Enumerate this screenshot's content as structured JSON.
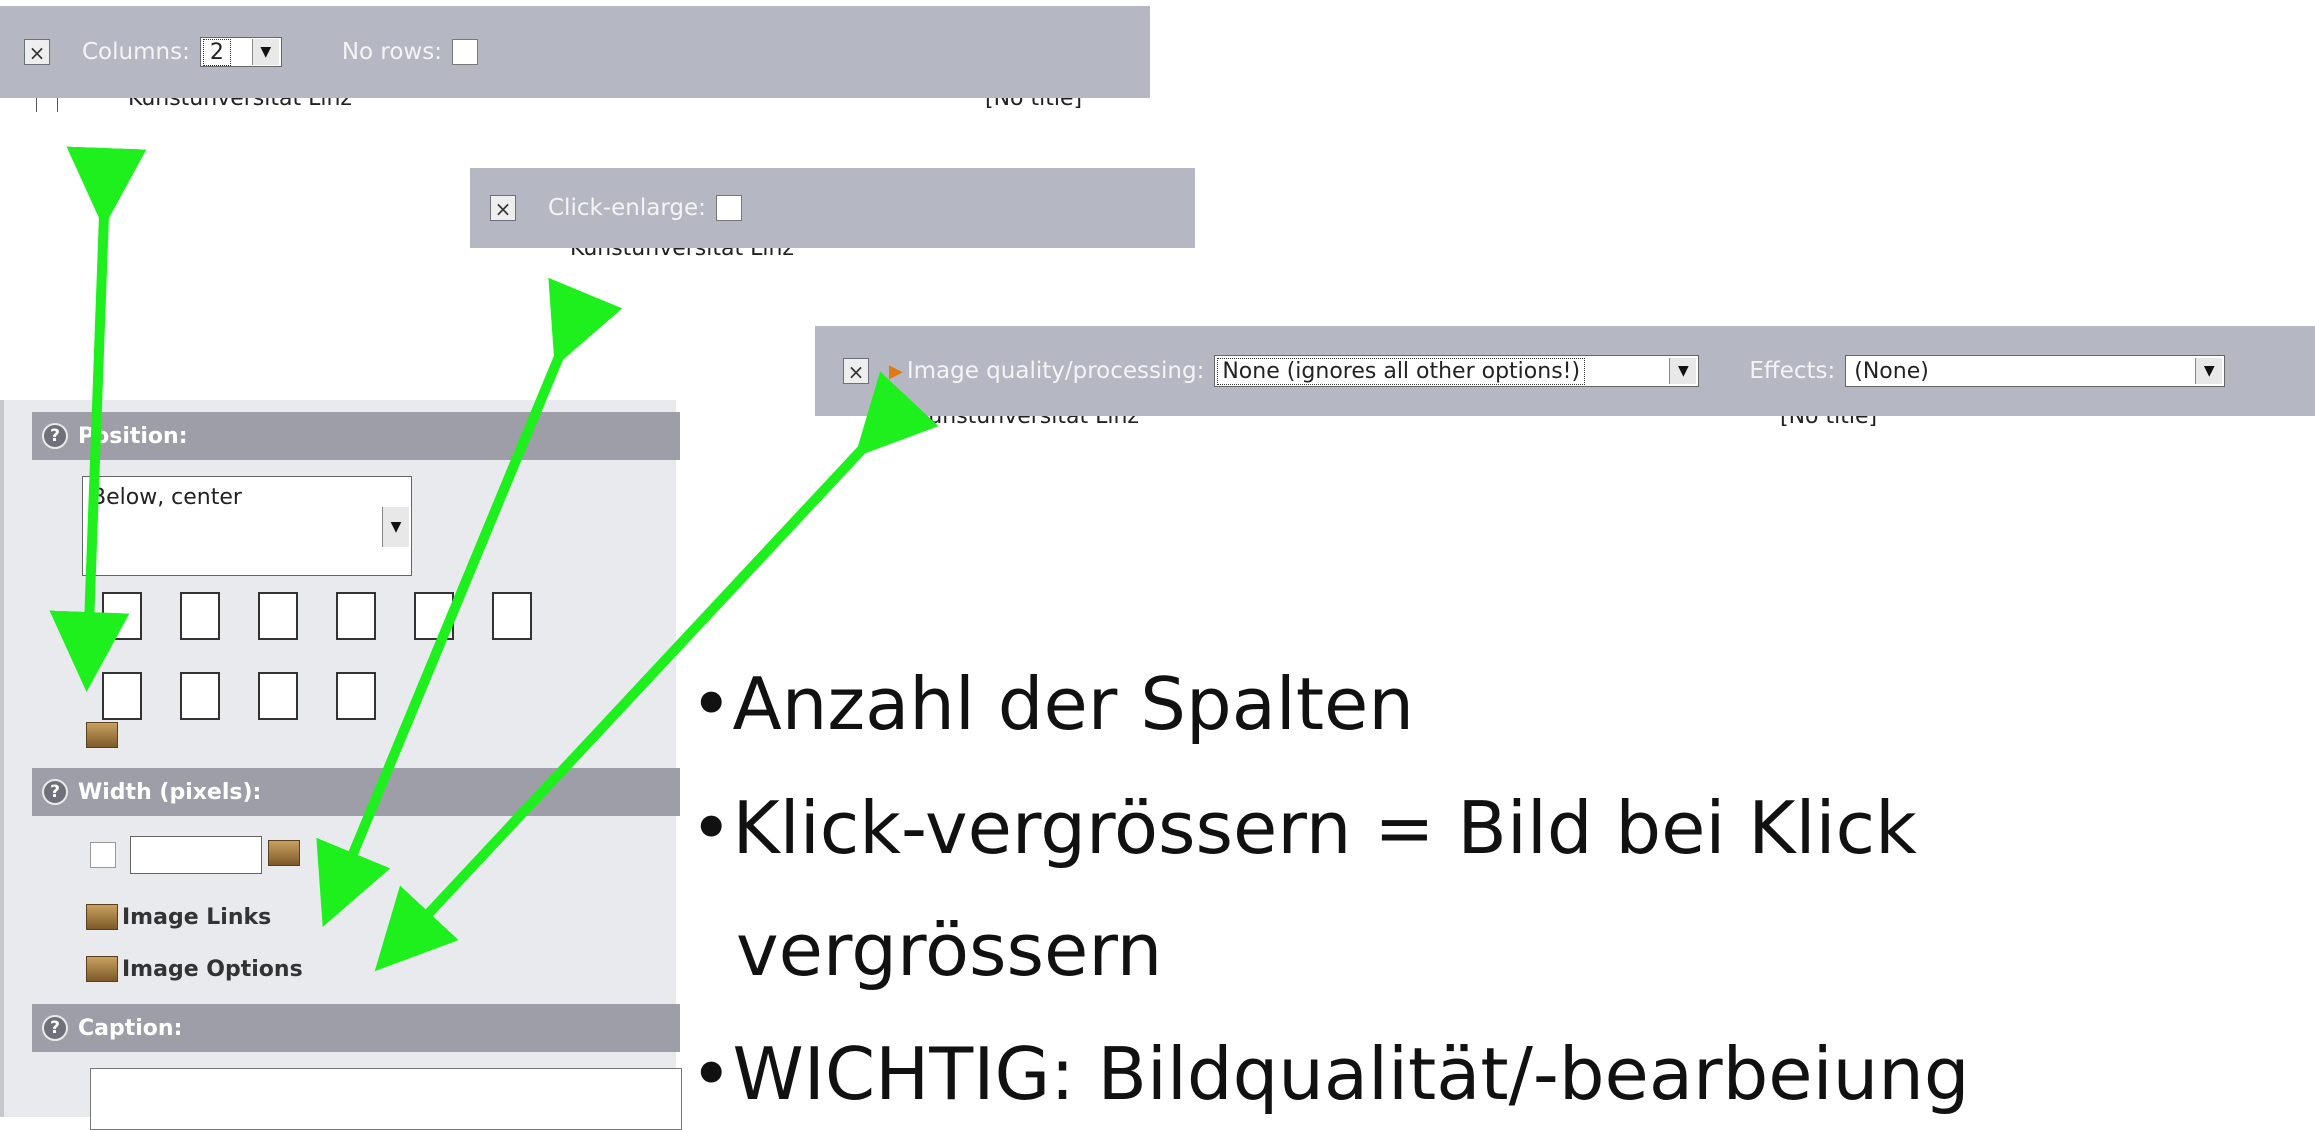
{
  "panel1": {
    "columns_label": "Columns:",
    "columns_value": "2",
    "no_rows_label": "No rows:",
    "row_text": "Kunstunversität Linz",
    "row_title": "[No title]"
  },
  "panel2": {
    "click_enlarge_label": "Click-enlarge:",
    "row_text": "Kunstunversität Linz"
  },
  "panel3": {
    "image_quality_label": "Image quality/processing:",
    "image_quality_value": "None (ignores all other options!)",
    "effects_label": "Effects:",
    "effects_value": "(None)",
    "row_text": "Kunstunversität Linz",
    "row_title": "[No title]"
  },
  "sidebar": {
    "position_label": "Position:",
    "position_value": "Below, center",
    "width_label": "Width (pixels):",
    "image_links_label": "Image Links",
    "image_options_label": "Image Options",
    "caption_label": "Caption:"
  },
  "bullets": {
    "b1": "•Anzahl der Spalten",
    "b2": "•Klick-vergrössern = Bild bei Klick",
    "b2b": "vergrössern",
    "b3": "•WICHTIG: Bildqualität/-bearbeiung"
  },
  "colors": {
    "arrow": "#1ef01e",
    "bar": "#b5b8c2",
    "section": "#9d9ea8"
  },
  "icons": [
    "close-icon",
    "dropdown-arrow-icon",
    "help-icon",
    "edit-icon",
    "page-icon",
    "position-icons"
  ]
}
